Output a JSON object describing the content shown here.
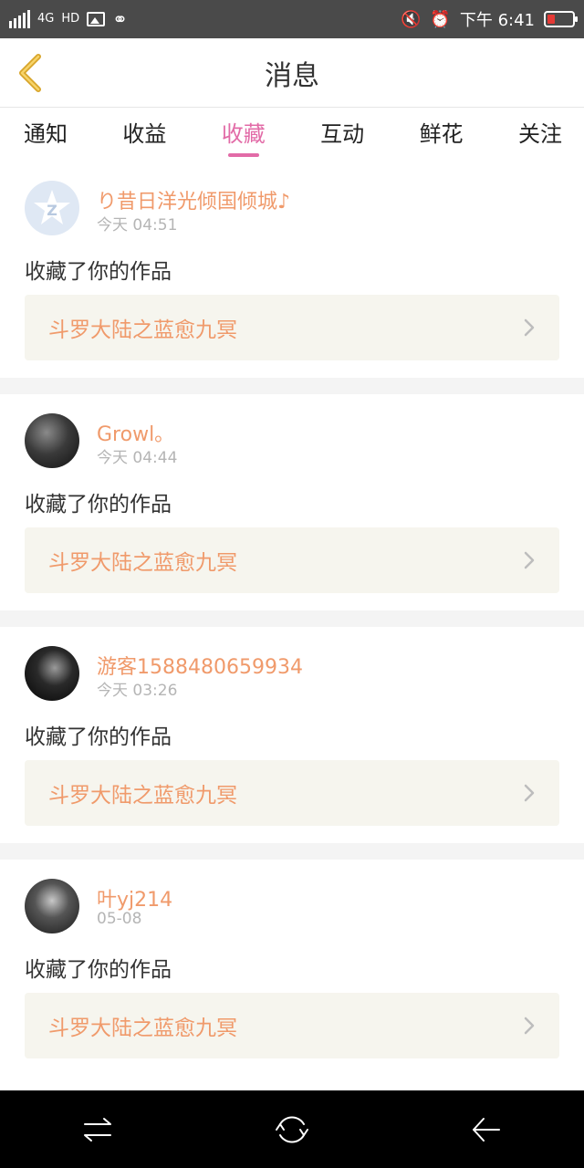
{
  "status_bar": {
    "network": "4G",
    "hd": "HD",
    "time": "下午 6:41",
    "battery_color": "#e53935"
  },
  "header": {
    "title": "消息",
    "back_icon": "chevron-left-icon"
  },
  "tabs": [
    {
      "label": "通知",
      "active": false
    },
    {
      "label": "收益",
      "active": false
    },
    {
      "label": "收藏",
      "active": true
    },
    {
      "label": "互动",
      "active": false
    },
    {
      "label": "鲜花",
      "active": false
    },
    {
      "label": "关注",
      "active": false
    }
  ],
  "colors": {
    "accent_pink": "#e26ba7",
    "name_orange": "#f09a6b",
    "card_bg": "#f6f5ee"
  },
  "messages": [
    {
      "user": "り昔日洋光倾国倾城♪",
      "time": "今天 04:51",
      "action": "收藏了你的作品",
      "work": "斗罗大陆之蓝愈九冥"
    },
    {
      "user": "Growl。",
      "time": "今天 04:44",
      "action": "收藏了你的作品",
      "work": "斗罗大陆之蓝愈九冥"
    },
    {
      "user": "游客1588480659934",
      "time": "今天 03:26",
      "action": "收藏了你的作品",
      "work": "斗罗大陆之蓝愈九冥"
    },
    {
      "user": "叶yj214",
      "time": "05-08",
      "action": "收藏了你的作品",
      "work": "斗罗大陆之蓝愈九冥"
    }
  ],
  "nav_bar": {
    "icons": [
      "menu-switch-icon",
      "home-icon",
      "back-arrow-icon"
    ]
  }
}
